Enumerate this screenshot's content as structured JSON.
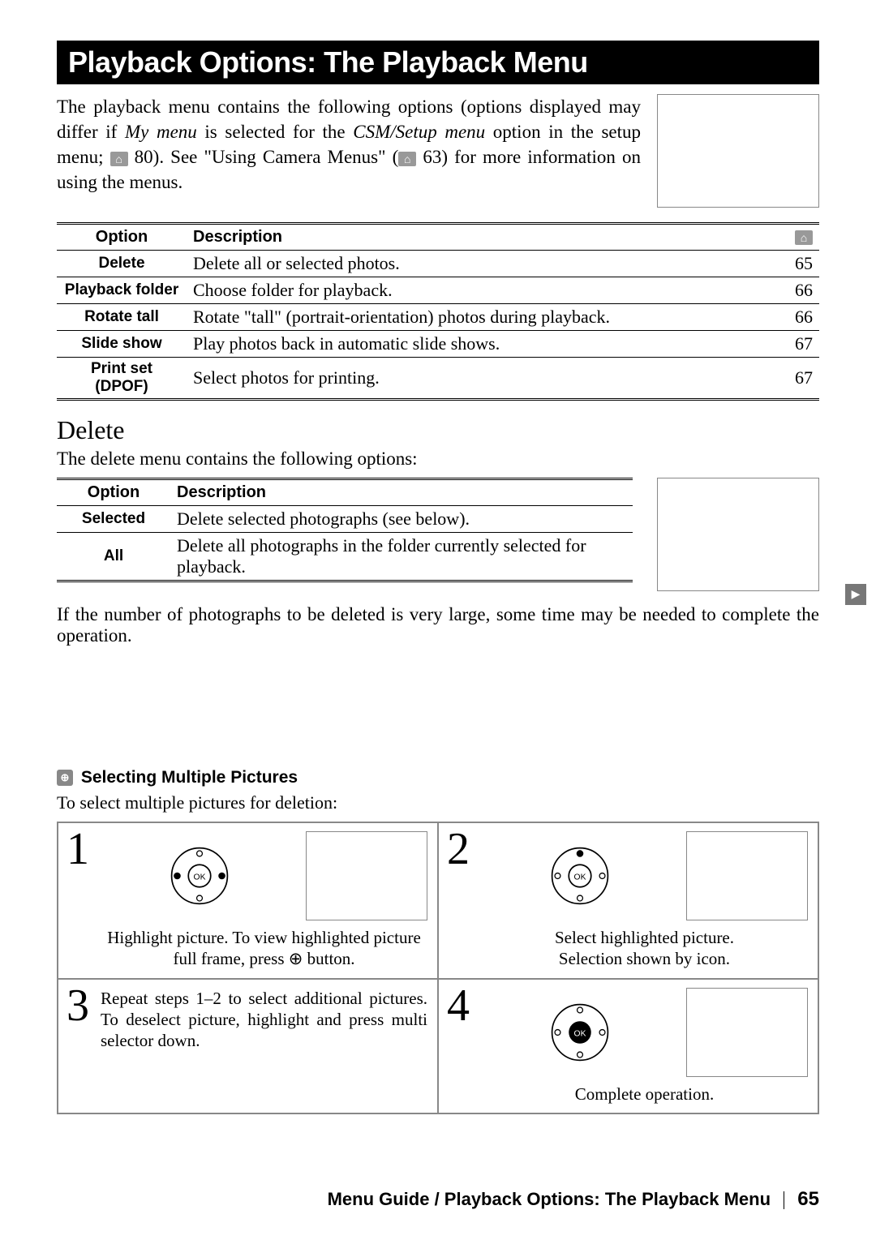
{
  "header": {
    "title": "Playback Options: The Playback Menu"
  },
  "intro": {
    "part1": "The playback menu contains the following options (options displayed may differ if ",
    "italic1": "My menu",
    "part2": " is selected for the ",
    "italic2": "CSM/Setup menu",
    "part3": " option in the setup menu; ",
    "ref1": "80).  See \"Using Camera Menus\" (",
    "ref2": "63) for more information on using the menus."
  },
  "options_table": {
    "headers": {
      "option": "Option",
      "description": "Description",
      "page_icon": "⌂"
    },
    "rows": [
      {
        "option": "Delete",
        "description": "Delete all or selected photos.",
        "page": "65"
      },
      {
        "option": "Playback folder",
        "description": "Choose folder for playback.",
        "page": "66"
      },
      {
        "option": "Rotate tall",
        "description": "Rotate \"tall\" (portrait-orientation) photos during playback.",
        "page": "66"
      },
      {
        "option": "Slide show",
        "description": "Play photos back in automatic slide shows.",
        "page": "67"
      },
      {
        "option": "Print set (DPOF)",
        "description": "Select photos for printing.",
        "page": "67"
      }
    ]
  },
  "delete_section": {
    "heading": "Delete",
    "intro": "The delete menu contains the following options:",
    "headers": {
      "option": "Option",
      "description": "Description"
    },
    "rows": [
      {
        "option": "Selected",
        "description": "Delete selected photographs (see below)."
      },
      {
        "option": "All",
        "description": "Delete all photographs in the folder currently selected for playback."
      }
    ],
    "note": "If the number of photographs to be deleted is very large, some time may be needed to complete the operation."
  },
  "tab_icon": "▶",
  "callout": {
    "icon": "⊕",
    "title": "Selecting Multiple Pictures",
    "intro": "To select multiple pictures for deletion:"
  },
  "steps": {
    "s1": {
      "num": "1",
      "caption_a": "Highlight picture.  To view highlighted picture full frame, press ",
      "caption_b": " button."
    },
    "s2": {
      "num": "2",
      "caption_a": "Select highlighted picture.",
      "caption_b": "Selection shown by icon."
    },
    "s3": {
      "num": "3",
      "body": "Repeat steps 1–2 to select additional pictures.  To deselect picture, highlight and press multi selector down."
    },
    "s4": {
      "num": "4",
      "caption": "Complete operation."
    }
  },
  "footer": {
    "text": "Menu Guide / Playback Options: The Playback Menu",
    "page": "65"
  }
}
